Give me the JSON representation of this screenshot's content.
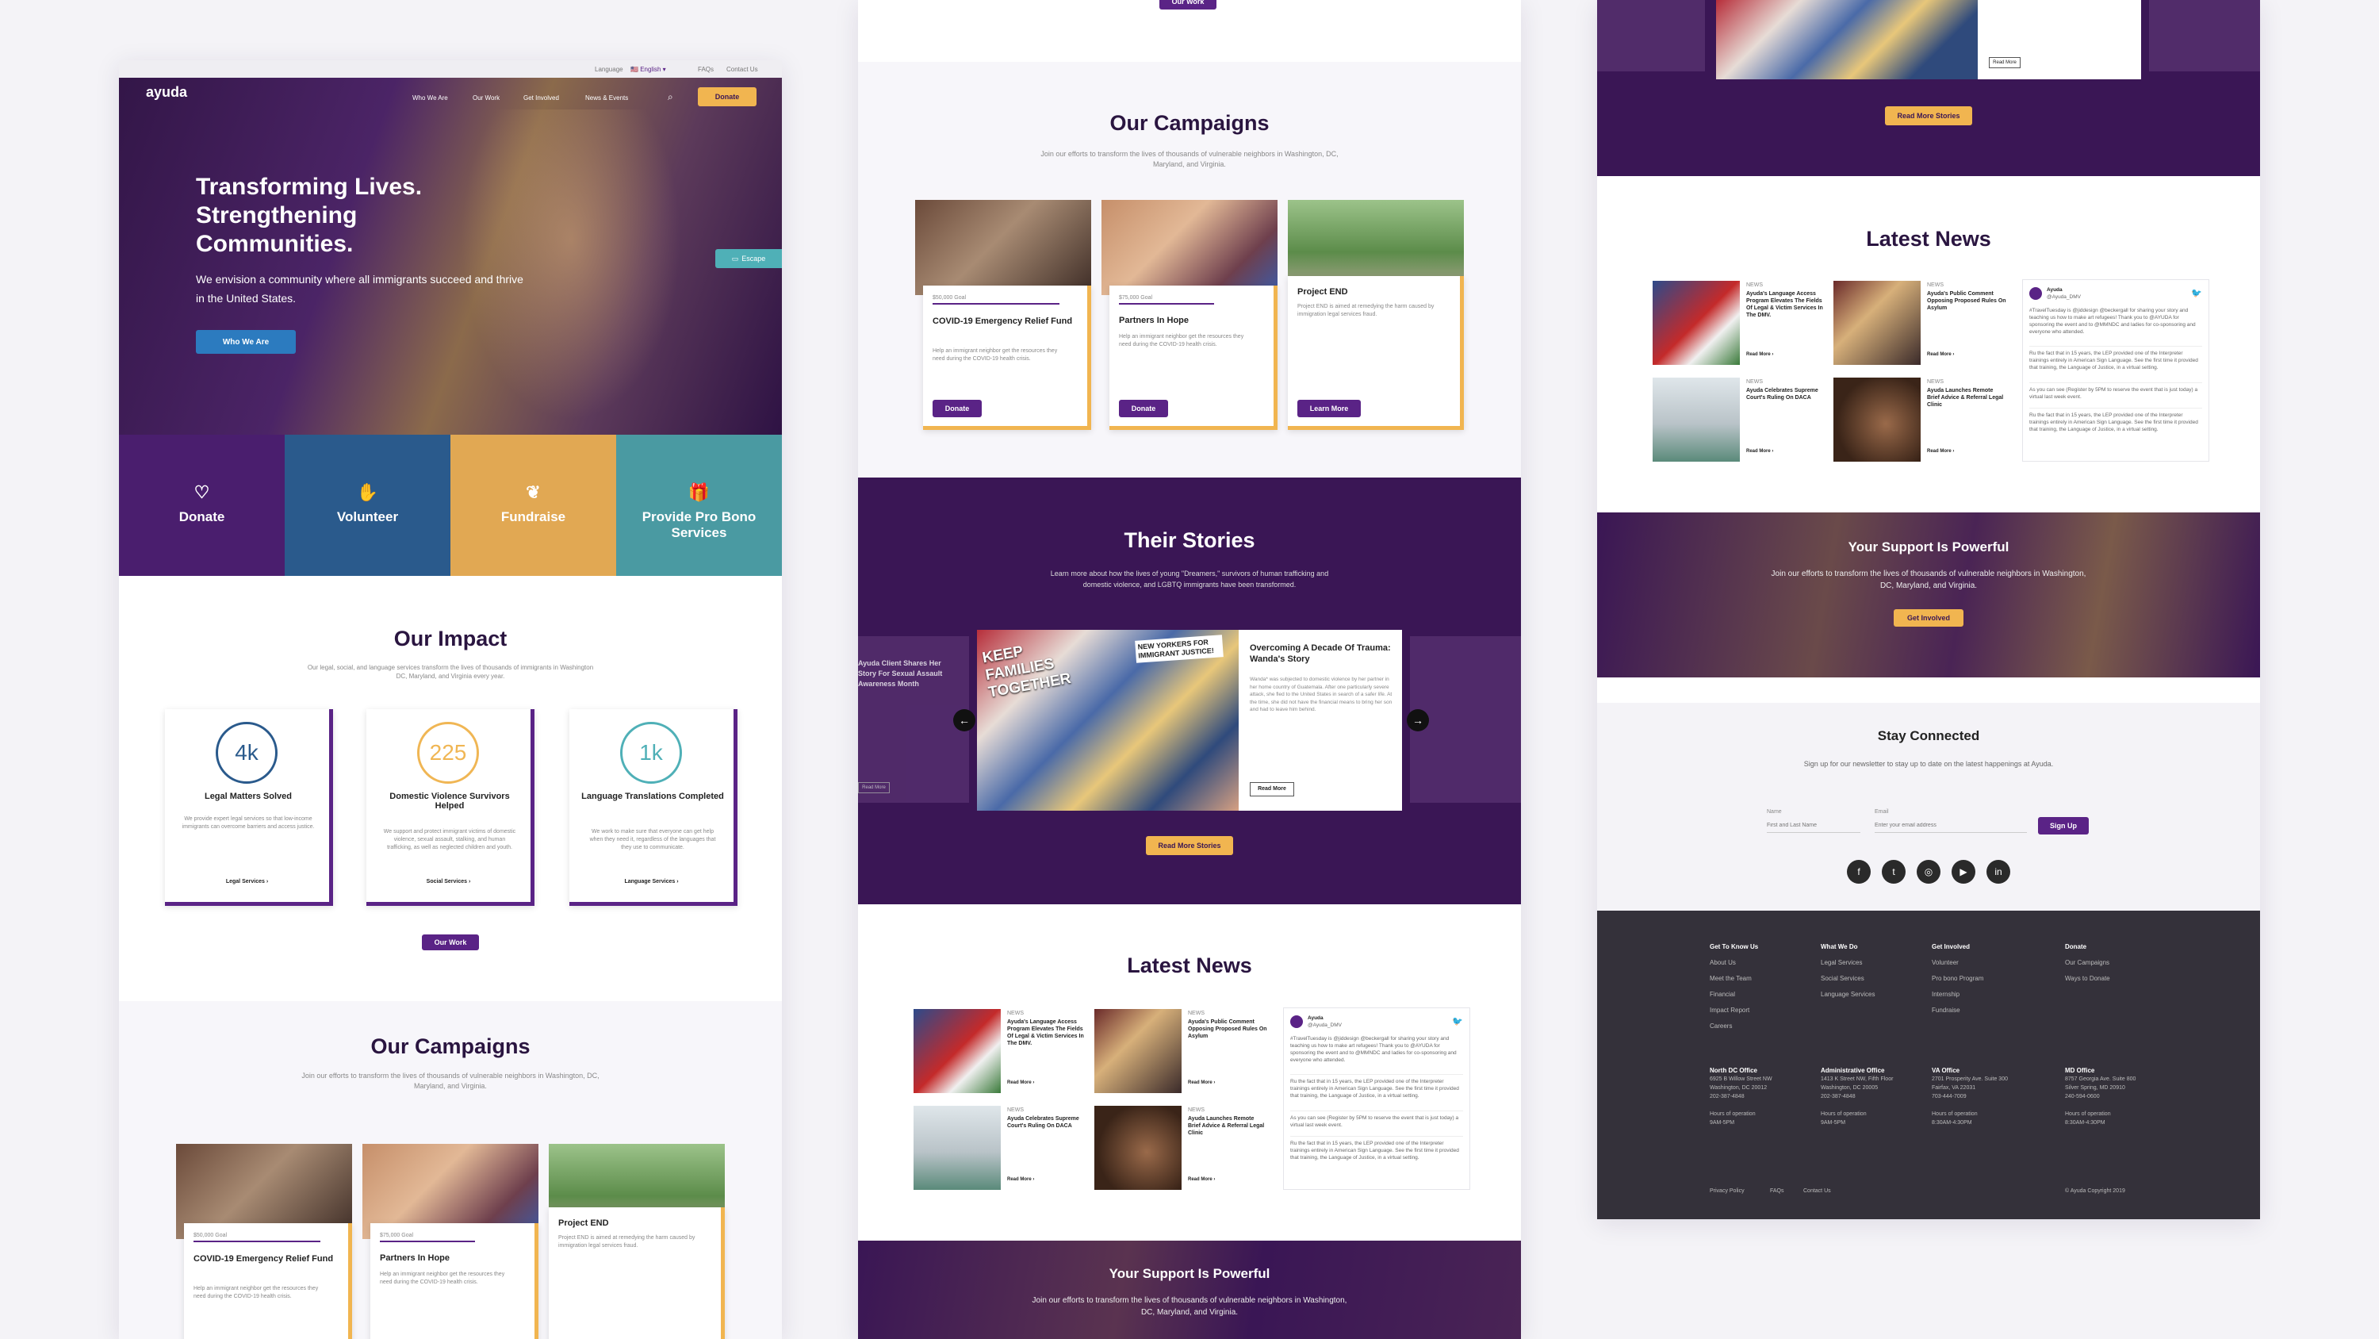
{
  "site": {
    "topbar": {
      "language_label": "Language",
      "language_value": "English",
      "faqs": "FAQs",
      "contact": "Contact Us"
    },
    "logo_text": "ayuda",
    "nav": [
      "Who We Are",
      "Our Work",
      "Get Involved",
      "News & Events"
    ],
    "donate_label": "Donate",
    "escape_label": "Escape"
  },
  "hero": {
    "title": "Transforming Lives. Strengthening Communities.",
    "text": "We envision a community where all immigrants succeed and thrive in the United States.",
    "button": "Who We Are"
  },
  "tiles": [
    {
      "label": "Donate",
      "icon": "heart-icon"
    },
    {
      "label": "Volunteer",
      "icon": "hand-icon"
    },
    {
      "label": "Fundraise",
      "icon": "gift-hand-icon"
    },
    {
      "label": "Provide Pro Bono Services",
      "icon": "gift-icon"
    }
  ],
  "impact": {
    "title": "Our Impact",
    "subtitle": "Our legal, social, and language services transform the lives of thousands of immigrants in Washington DC, Maryland, and Virginia every year.",
    "cards": [
      {
        "value": "4k",
        "label": "Legal Matters Solved",
        "text": "We provide expert legal services so that low-income immigrants can overcome barriers and access justice.",
        "link": "Legal Services ›",
        "color": "#2a5a8c"
      },
      {
        "value": "225",
        "label": "Domestic Violence Survivors Helped",
        "text": "We support and protect immigrant victims of domestic violence, sexual assault, stalking, and human trafficking, as well as neglected children and youth.",
        "link": "Social Services ›",
        "color": "#f0b654"
      },
      {
        "value": "1k",
        "label": "Language Translations Completed",
        "text": "We work to make sure that everyone can get help when they need it, regardless of the languages that they use to communicate.",
        "link": "Language Services ›",
        "color": "#4fb0b7"
      }
    ],
    "button": "Our Work"
  },
  "campaigns": {
    "title": "Our Campaigns",
    "subtitle": "Join our efforts to transform the lives of thousands of vulnerable neighbors in Washington, DC, Maryland, and Virginia.",
    "items": [
      {
        "goal": "$50,000 Goal",
        "title": "COVID-19 Emergency Relief Fund",
        "text": "Help an immigrant neighbor get the resources they need during the COVID-19 health crisis.",
        "button": "Donate"
      },
      {
        "goal": "$75,000 Goal",
        "title": "Partners In Hope",
        "text": "Help an immigrant neighbor get the resources they need during the COVID-19 health crisis.",
        "button": "Donate"
      },
      {
        "goal": "",
        "title": "Project END",
        "text": "Project END is aimed at remedying the harm caused by immigration legal services fraud.",
        "button": "Learn More"
      }
    ]
  },
  "stories": {
    "title": "Their Stories",
    "subtitle": "Learn more about how the lives of young \"Dreamers,\" survivors of human trafficking and domestic violence, and LGBTQ immigrants have been transformed.",
    "side_title": "Ayuda Client Shares Her Story For Sexual Assault Awareness Month",
    "side_button": "Read More",
    "card_title": "Overcoming A Decade Of Trauma: Wanda's Story",
    "card_text": "Wanda* was subjected to domestic violence by her partner in her home country of Guatemala. After one particularly severe attack, she fled to the United States in search of a safer life. At the time, she did not have the financial means to bring her son and had to leave him behind.",
    "card_button": "Read More",
    "photo_sign": "KEEP FAMILIES TOGETHER",
    "photo_sign2": "NEW YORKERS FOR IMMIGRANT JUSTICE!",
    "button": "Read More Stories",
    "prev": "←",
    "next": "→"
  },
  "news": {
    "title": "Latest News",
    "tag": "NEWS",
    "read_more": "Read More ›",
    "items": [
      {
        "title": "Ayuda's Language Access Program Elevates The Fields Of Legal & Victim Services In The DMV."
      },
      {
        "title": "Ayuda's Public Comment Opposing Proposed Rules On Asylum"
      },
      {
        "title": "Ayuda Celebrates Supreme Court's Ruling On DACA"
      },
      {
        "title": "Ayuda Launches Remote Brief Advice & Referral Legal Clinic"
      }
    ],
    "tweet_name": "Ayuda",
    "tweet_handle": "@Ayuda_DMV",
    "tweets": [
      "#TravelTuesday is @jiddesign @beckergall for sharing your story and teaching us how to make art refugees! Thank you to @AYUDA for sponsoring the event and to @MMNDC and ladies for co-sponsoring and everyone who attended.",
      "Ru the fact that in 15 years, the LEP provided one of the Interpreter trainings entirely in American Sign Language. See the first time it provided that training, the Language of Justice, in a virtual setting.",
      "As you can see (Register by 5PM to reserve the event that is just today) a virtual last week event.",
      "Ru the fact that in 15 years, the LEP provided one of the Interpreter trainings entirely in American Sign Language. See the first time it provided that training, the Language of Justice, in a virtual setting."
    ]
  },
  "support": {
    "title": "Your Support Is Powerful",
    "text": "Join our efforts to transform the lives of thousands of vulnerable neighbors in Washington, DC, Maryland, and Virginia.",
    "button": "Get Involved"
  },
  "col3_top_button": "Read More",
  "col3_read_stories": "Read More Stories",
  "newsletter": {
    "title": "Stay Connected",
    "text": "Sign up for our newsletter to stay up to date on the latest happenings at Ayuda.",
    "name_label": "Name",
    "name_placeholder": "First and Last Name",
    "email_label": "Email",
    "email_placeholder": "Enter your email address",
    "button": "Sign Up"
  },
  "footer": {
    "cols": [
      {
        "heading": "Get To Know Us",
        "links": [
          "About Us",
          "Meet the Team",
          "Financial",
          "Impact Report",
          "Careers"
        ]
      },
      {
        "heading": "What We Do",
        "links": [
          "Legal Services",
          "Social Services",
          "Language Services"
        ]
      },
      {
        "heading": "Get Involved",
        "links": [
          "Volunteer",
          "Pro bono Program",
          "Internship",
          "Fundraise"
        ]
      },
      {
        "heading": "Donate",
        "links": [
          "Our Campaigns",
          "Ways to Donate"
        ]
      }
    ],
    "offices": [
      {
        "name": "North DC Office",
        "lines": [
          "6925 B Willow Street NW",
          "Washington, DC 20012",
          "202-387-4848",
          "",
          "Hours of operation",
          "9AM-5PM"
        ]
      },
      {
        "name": "Administrative Office",
        "lines": [
          "1413 K Street NW, Fifth Floor",
          "Washington, DC 20005",
          "202-387-4848",
          "",
          "Hours of operation",
          "9AM-5PM"
        ]
      },
      {
        "name": "VA Office",
        "lines": [
          "2701 Prosperity Ave. Suite 300",
          "Fairfax, VA 22031",
          "703-444-7009",
          "",
          "Hours of operation",
          "8:30AM-4:30PM"
        ]
      },
      {
        "name": "MD Office",
        "lines": [
          "8757 Georgia Ave. Suite 800",
          "Silver Spring, MD 20910",
          "240-594-0600",
          "",
          "Hours of operation",
          "8:30AM-4:30PM"
        ]
      }
    ],
    "bottom": [
      "Privacy Policy",
      "FAQs",
      "Contact Us"
    ],
    "copyright": "© Ayuda Copyright 2019"
  },
  "colors": {
    "purple": "#3a1655",
    "gold": "#f1b550",
    "teal": "#4fb0b7",
    "blue": "#2a5a8c",
    "footer": "#34313a"
  }
}
